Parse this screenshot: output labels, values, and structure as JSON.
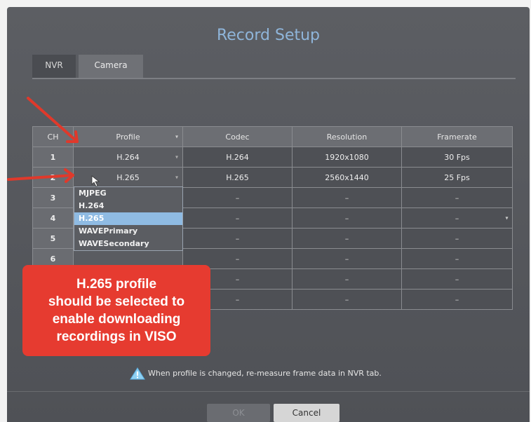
{
  "title": "Record Setup",
  "tabs": [
    {
      "label": "NVR"
    },
    {
      "label": "Camera"
    }
  ],
  "table": {
    "headers": [
      "CH",
      "Profile",
      "Codec",
      "Resolution",
      "Framerate"
    ],
    "rows": [
      {
        "ch": "1",
        "profile": "H.264",
        "codec": "H.264",
        "resolution": "1920x1080",
        "framerate": "30 Fps"
      },
      {
        "ch": "2",
        "profile": "H.265",
        "codec": "H.265",
        "resolution": "2560x1440",
        "framerate": "25 Fps"
      },
      {
        "ch": "3",
        "profile": "",
        "codec": "–",
        "resolution": "–",
        "framerate": "–"
      },
      {
        "ch": "4",
        "profile": "",
        "codec": "–",
        "resolution": "–",
        "framerate": "–"
      },
      {
        "ch": "5",
        "profile": "",
        "codec": "–",
        "resolution": "–",
        "framerate": "–"
      },
      {
        "ch": "6",
        "profile": "",
        "codec": "–",
        "resolution": "–",
        "framerate": "–"
      },
      {
        "ch": "",
        "profile": "",
        "codec": "–",
        "resolution": "–",
        "framerate": "–"
      },
      {
        "ch": "",
        "profile": "",
        "codec": "–",
        "resolution": "–",
        "framerate": "–"
      }
    ]
  },
  "dropdown": {
    "options": [
      "MJPEG",
      "H.264",
      "H.265",
      "WAVEPrimary",
      "WAVESecondary"
    ],
    "selected": "H.265"
  },
  "callout": {
    "lines": [
      "H.265 profile",
      "should be selected to",
      "enable downloading",
      "recordings in VISO"
    ],
    "color": "#e63b30"
  },
  "warning_text": "When profile is changed, re-measure frame data in NVR tab.",
  "buttons": {
    "ok": "OK",
    "cancel": "Cancel"
  },
  "colors": {
    "title": "#8fb5da",
    "selected_option": "#8fbbe3",
    "arrow": "#e0392b"
  }
}
